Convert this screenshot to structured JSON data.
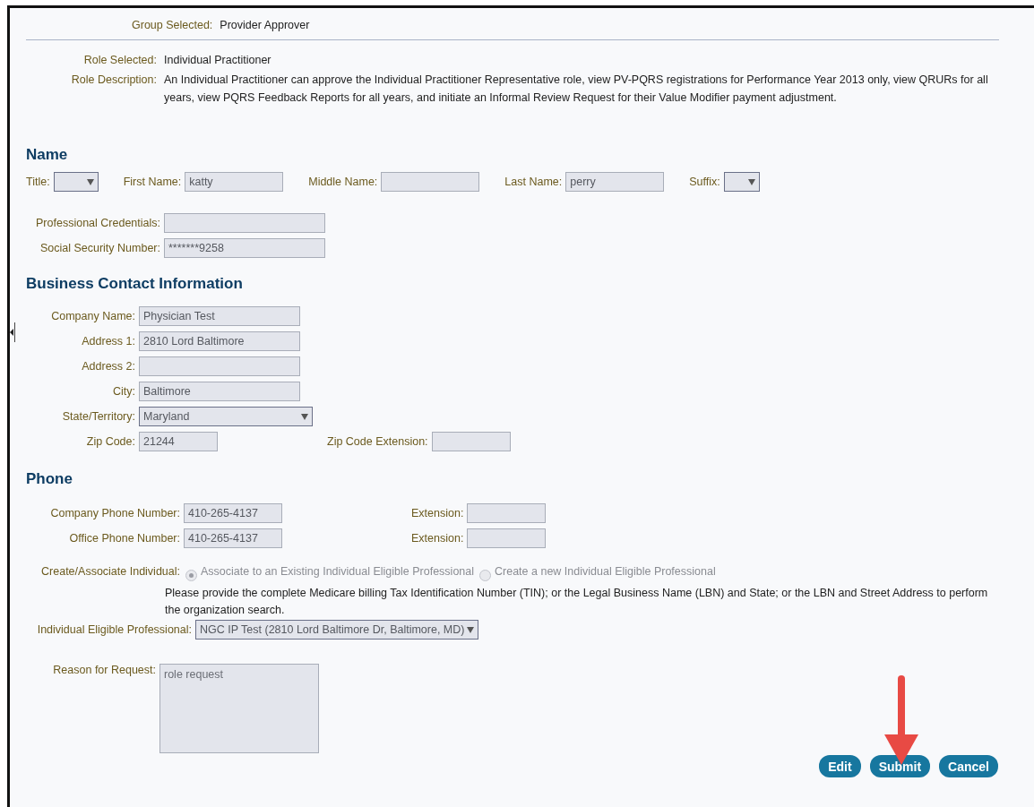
{
  "group": {
    "label": "Group Selected:",
    "value": "Provider Approver"
  },
  "role": {
    "selected_label": "Role Selected:",
    "selected_value": "Individual Practitioner",
    "description_label": "Role Description:",
    "description": "An Individual Practitioner can approve the Individual Practitioner Representative role, view PV-PQRS registrations for Performance Year 2013 only, view QRURs for all years, view PQRS Feedback Reports for all years, and initiate an Informal Review Request for their Value Modifier payment adjustment."
  },
  "name_section": {
    "heading": "Name",
    "title": {
      "label": "Title:"
    },
    "first_name": {
      "label": "First Name:",
      "value": "katty"
    },
    "middle_name": {
      "label": "Middle Name:"
    },
    "last_name": {
      "label": "Last Name:",
      "value": "perry"
    },
    "suffix": {
      "label": "Suffix:"
    },
    "credentials": {
      "label": "Professional Credentials:"
    },
    "ssn": {
      "label": "Social Security Number:",
      "value": "*******9258"
    }
  },
  "business": {
    "heading": "Business Contact Information",
    "fields": [
      {
        "kind": "text",
        "label": "Company Name:",
        "value": "Physician Test"
      },
      {
        "kind": "text",
        "label": "Address 1:",
        "value": "2810 Lord Baltimore"
      },
      {
        "kind": "text",
        "label": "Address 2:"
      },
      {
        "kind": "text",
        "label": "City:",
        "value": "Baltimore"
      },
      {
        "kind": "select",
        "label": "State/Territory:",
        "value": "Maryland"
      }
    ],
    "zip": {
      "label": "Zip Code:",
      "value": "21244"
    },
    "zip_extension": {
      "label": "Zip Code Extension:"
    }
  },
  "phone": {
    "heading": "Phone",
    "rows": [
      {
        "label": "Company Phone Number:",
        "value": "410-265-4137",
        "extension_label": "Extension:"
      },
      {
        "label": "Office Phone Number:",
        "value": "410-265-4137",
        "extension_label": "Extension:"
      }
    ]
  },
  "create_associate": {
    "label": "Create/Associate Individual:",
    "options": [
      {
        "label": "Associate to an Existing Individual Eligible Professional",
        "selected": true
      },
      {
        "label": "Create a new Individual Eligible Professional",
        "selected": false
      }
    ],
    "help": "Please provide the complete Medicare billing Tax Identification Number (TIN); or the Legal Business Name (LBN) and State; or the LBN and Street Address to perform the organization search."
  },
  "eligible_professional": {
    "label": "Individual Eligible Professional:",
    "value": "NGC IP Test (2810 Lord Baltimore Dr, Baltimore, MD)"
  },
  "reason": {
    "label": "Reason for Request:",
    "value": "role request"
  },
  "buttons": [
    {
      "label": "Edit"
    },
    {
      "label": "Submit"
    },
    {
      "label": "Cancel"
    }
  ]
}
